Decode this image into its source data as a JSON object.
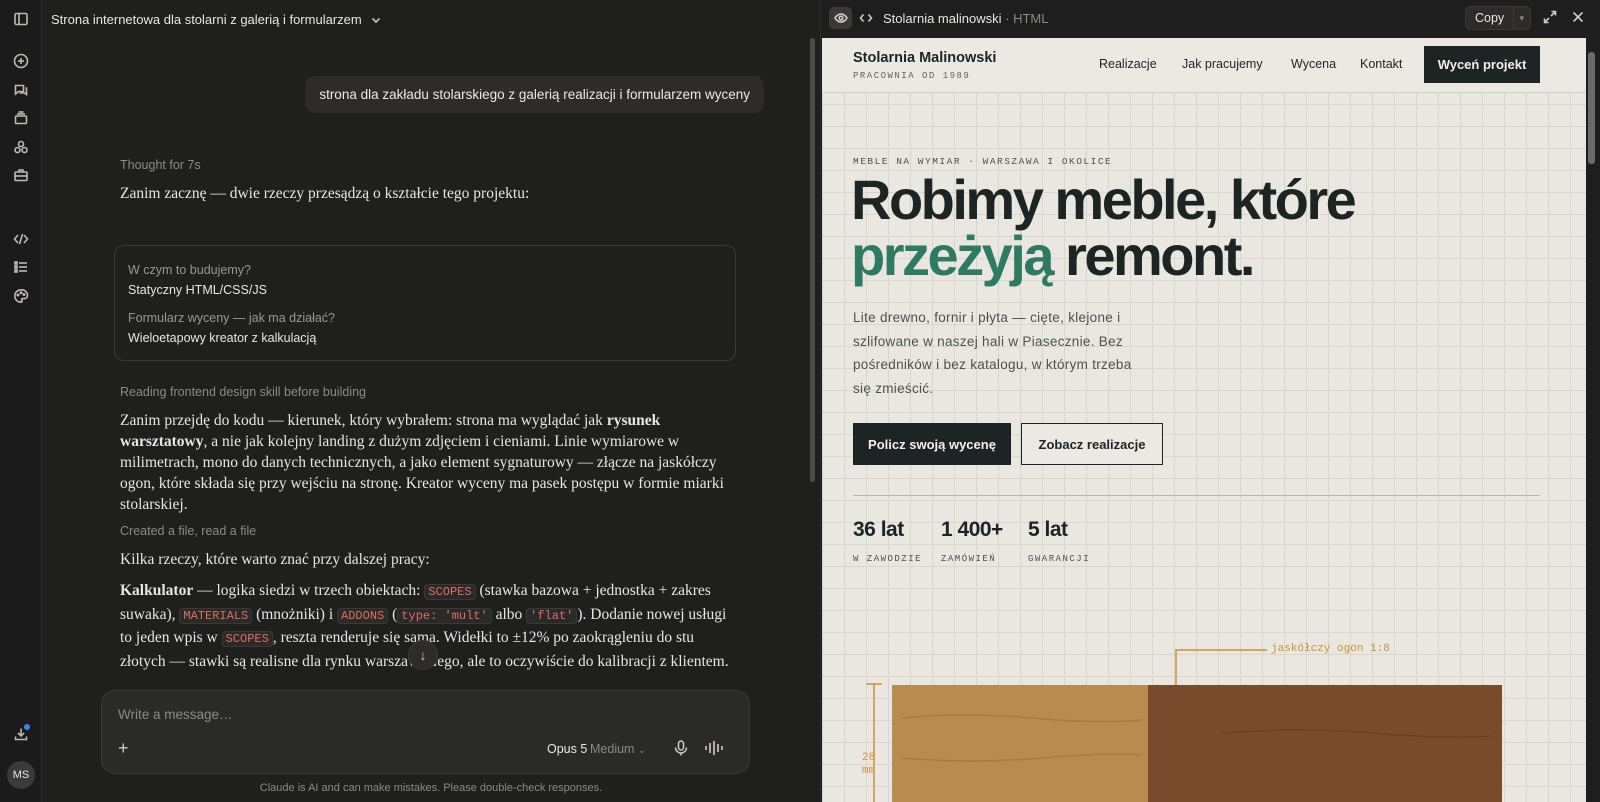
{
  "rail": {
    "avatar_initials": "MS"
  },
  "chat": {
    "title": "Strona internetowa dla stolarni z galerią i formularzem",
    "user_message": "strona dla zakładu stolarskiego z galerią realizacji i formularzem wyceny",
    "thought": "Thought for 7s",
    "intro": "Zanim zacznę — dwie rzeczy przesądzą o kształcie tego projektu:",
    "questions": [
      {
        "q": "W czym to budujemy?",
        "a": "Statyczny HTML/CSS/JS"
      },
      {
        "q": "Formularz wyceny — jak ma działać?",
        "a": "Wieloetapowy kreator z kalkulacją"
      }
    ],
    "reading_status": "Reading frontend design skill before building",
    "p1_a": "Zanim przejdę do kodu — kierunek, który wybrałem: strona ma wyglądać jak ",
    "p1_b": "rysunek warsztatowy",
    "p1_c": ", a nie jak kolejny landing z dużym zdjęciem i cieniami. Linie wymiarowe w milimetrach, mono do danych technicznych, a jako element sygnaturowy — złącze na jaskółczy ogon, które składa się przy wejściu na stronę. Kreator wyceny ma pasek postępu w formie miarki stolarskiej.",
    "created_status": "Created a file, read a file",
    "p2": "Kilka rzeczy, które warto znać przy dalszej pracy:",
    "p3_label": "Kalkulator",
    "p3_a": " — logika siedzi w trzech obiektach: ",
    "code_scopes": "SCOPES",
    "p3_b": " (stawka bazowa + jednostka + zakres suwaka), ",
    "code_materials": "MATERIALS",
    "p3_c": " (mnożniki) i ",
    "code_addons": "ADDONS",
    "p3_d": " (",
    "code_type": "type: 'mult'",
    "p3_e": " albo ",
    "code_flat": "'flat'",
    "p3_f": "). Dodanie nowej usługi to jeden wpis w ",
    "code_scopes2": "SCOPES",
    "p3_g": ", reszta renderuje się sama. Widełki to ±12% po zaokrągleniu do stu złotych — stawki są realis",
    "p3_h": "ne dla rynku warszawskiego, ale to oczywiście do kalibracji z klientem.",
    "composer_placeholder": "Write a message…",
    "model": "Opus 5",
    "effort": "Medium",
    "disclaimer": "Claude is AI and can make mistakes. Please double-check responses."
  },
  "preview": {
    "title": "Stolarnia malinowski",
    "format": "· HTML",
    "copy_label": "Copy"
  },
  "site": {
    "brand": "Stolarnia Malinowski",
    "brand_sub": "PRACOWNIA OD 1989",
    "nav": [
      "Realizacje",
      "Jak pracujemy",
      "Wycena",
      "Kontakt"
    ],
    "nav_cta": "Wyceń projekt",
    "eyebrow": "MEBLE NA WYMIAR · WARSZAWA I OKOLICE",
    "h1_line1": "Robimy meble, które",
    "h1_accent": "przeżyją",
    "h1_rest": " remont.",
    "lead": "Lite drewno, fornir i płyta — cięte, klejone i szlifowane w naszej hali w Piasecznie. Bez pośredników i bez katalogu, w którym trzeba się zmieścić.",
    "btn_primary": "Policz swoją wycenę",
    "btn_secondary": "Zobacz realizacje",
    "stats": [
      {
        "value": "36 lat",
        "label": "W ZAWODZIE"
      },
      {
        "value": "1 400+",
        "label": "ZAMÓWIEŃ"
      },
      {
        "value": "5 lat",
        "label": "GWARANCJI"
      }
    ],
    "joint_label": "jaskółczy ogon 1:8",
    "dim_value": "28",
    "dim_unit": "mm"
  },
  "colors": {
    "accent_green": "#2f7a62",
    "ink": "#1c2523",
    "wood_light": "#b98b4e",
    "wood_dark": "#7a4a2c",
    "dimension": "#c7953a"
  }
}
